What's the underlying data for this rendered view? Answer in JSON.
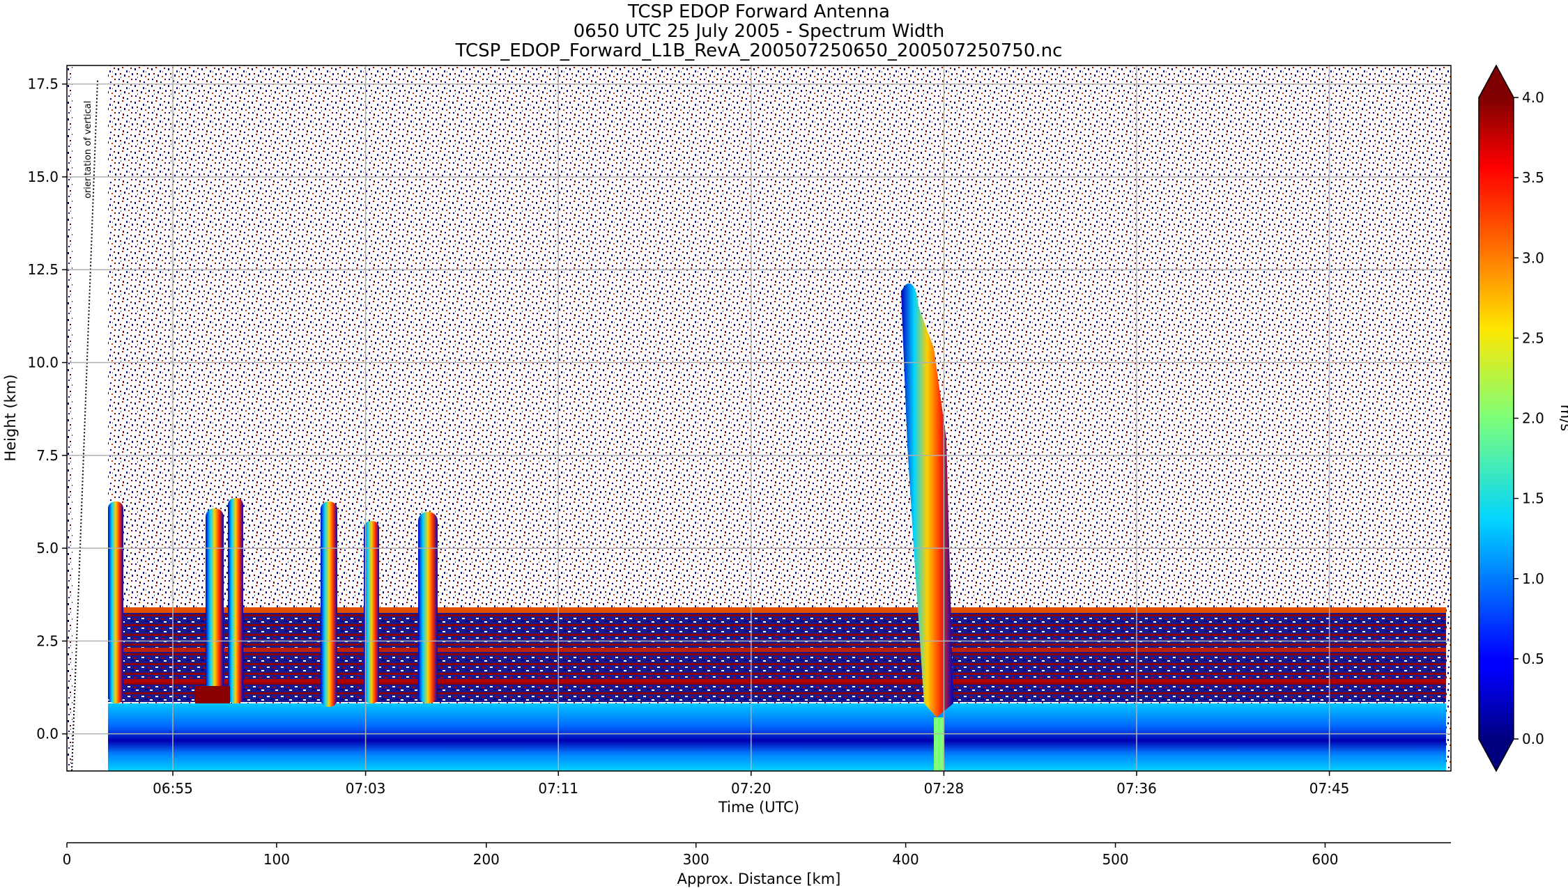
{
  "chart_data": {
    "type": "heatmap",
    "title": [
      "TCSP EDOP Forward Antenna",
      "0650 UTC 25 July 2005 - Spectrum Width",
      "TCSP_EDOP_Forward_L1B_RevA_200507250650_200507250750.nc"
    ],
    "xlabel": "Time (UTC)",
    "ylabel": "Height (km)",
    "x_ticks": [
      "06:55",
      "07:03",
      "07:11",
      "07:20",
      "07:28",
      "07:36",
      "07:45"
    ],
    "y_ticks": [
      "0.0",
      "2.5",
      "5.0",
      "7.5",
      "10.0",
      "12.5",
      "15.0",
      "17.5"
    ],
    "y_tick_values": [
      0.0,
      2.5,
      5.0,
      7.5,
      10.0,
      12.5,
      15.0,
      17.5
    ],
    "ylim": [
      -1.0,
      18.0
    ],
    "grid": true,
    "annotation": "orientation of vertical",
    "colorbar": {
      "label": "m/s",
      "ticks": [
        "0.0",
        "0.5",
        "1.0",
        "1.5",
        "2.0",
        "2.5",
        "3.0",
        "3.5",
        "4.0"
      ],
      "tick_values": [
        0.0,
        0.5,
        1.0,
        1.5,
        2.0,
        2.5,
        3.0,
        3.5,
        4.0
      ],
      "range": [
        0.0,
        4.0
      ],
      "colormap": "jet",
      "extend": "both"
    },
    "secondary_x_axis": {
      "label": "Approx. Distance [km]",
      "ticks": [
        "0",
        "100",
        "200",
        "300",
        "400",
        "500",
        "600"
      ],
      "tick_values": [
        0,
        100,
        200,
        300,
        400,
        500,
        600
      ],
      "range": [
        0,
        660
      ]
    },
    "features": [
      {
        "feature": "surface echo",
        "height_range_km": [
          -1.0,
          0.7
        ]
      },
      {
        "feature": "melting layer / bright band",
        "height_km": 3.3
      },
      {
        "feature": "convective cell",
        "time": "06:52",
        "top_km": 6.0
      },
      {
        "feature": "convective cell",
        "time": "06:57",
        "top_km": 6.3
      },
      {
        "feature": "convective cell",
        "time": "07:01",
        "top_km": 6.2
      },
      {
        "feature": "convective cell",
        "time": "07:03",
        "top_km": 5.7
      },
      {
        "feature": "convective cell",
        "time": "07:06",
        "top_km": 6.0
      },
      {
        "feature": "deep convective tower",
        "time": "07:28",
        "top_km": 12.5
      }
    ]
  }
}
